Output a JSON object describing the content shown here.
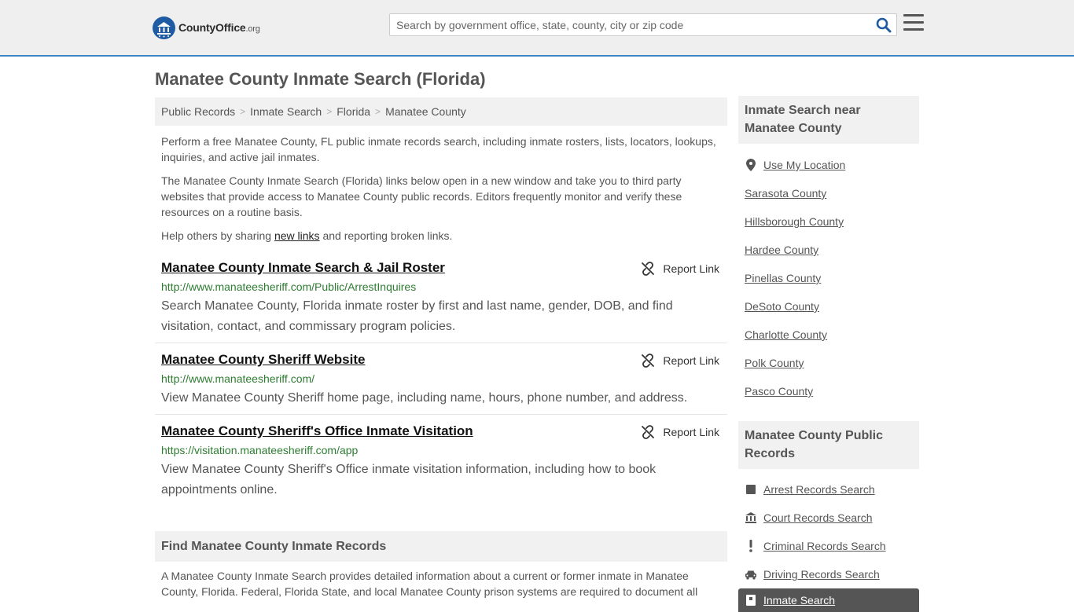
{
  "header": {
    "logo_main": "CountyOffice",
    "logo_tld": ".org",
    "search_placeholder": "Search by government office, state, county, city or zip code",
    "search_icon": "search-icon",
    "menu_icon": "hamburger-menu-icon"
  },
  "page": {
    "title": "Manatee County Inmate Search (Florida)"
  },
  "breadcrumb": [
    {
      "label": "Public Records"
    },
    {
      "label": "Inmate Search"
    },
    {
      "label": "Florida"
    },
    {
      "label": "Manatee County"
    }
  ],
  "intro": {
    "p1": "Perform a free Manatee County, FL public inmate records search, including inmate rosters, lists, locators, lookups, inquiries, and active jail inmates.",
    "p2": "The Manatee County Inmate Search (Florida) links below open in a new window and take you to third party websites that provide access to Manatee County public records. Editors frequently monitor and verify these resources on a routine basis.",
    "p3_before": "Help others by sharing ",
    "p3_link": "new links",
    "p3_after": " and reporting broken links."
  },
  "results": [
    {
      "title": "Manatee County Inmate Search & Jail Roster",
      "url": "http://www.manateesheriff.com/Public/ArrestInquires",
      "description": "Search Manatee County, Florida inmate roster by first and last name, gender, DOB, and find visitation, contact, and commissary program policies.",
      "report_label": "Report Link"
    },
    {
      "title": "Manatee County Sheriff Website",
      "url": "http://www.manateesheriff.com/",
      "description": "View Manatee County Sheriff home page, including name, hours, phone number, and address.",
      "report_label": "Report Link"
    },
    {
      "title": "Manatee County Sheriff's Office Inmate Visitation",
      "url": "https://visitation.manateesheriff.com/app",
      "description": "View Manatee County Sheriff's Office inmate visitation information, including how to book appointments online.",
      "report_label": "Report Link"
    }
  ],
  "find_section": {
    "heading": "Find Manatee County Inmate Records",
    "text": "A Manatee County Inmate Search provides detailed information about a current or former inmate in Manatee County, Florida. Federal, Florida State, and local Manatee County prison systems are required to document all"
  },
  "sidebar": {
    "nearby_heading": "Inmate Search near Manatee County",
    "use_location": "Use My Location",
    "nearby": [
      "Sarasota County",
      "Hillsborough County",
      "Hardee County",
      "Pinellas County",
      "DeSoto County",
      "Charlotte County",
      "Polk County",
      "Pasco County"
    ],
    "records_heading": "Manatee County Public Records",
    "records": [
      {
        "label": "Arrest Records Search",
        "icon": "square-icon"
      },
      {
        "label": "Court Records Search",
        "icon": "courthouse-icon"
      },
      {
        "label": "Criminal Records Search",
        "icon": "exclamation-icon"
      },
      {
        "label": "Driving Records Search",
        "icon": "car-icon"
      }
    ],
    "active_record": {
      "label": "Inmate Search",
      "icon": "inmate-icon"
    }
  },
  "colors": {
    "accent_border": "#3c84c4",
    "logo_blue": "#1f5ba3",
    "url_green": "#2e7d32",
    "panel_gray": "#f1f1f1",
    "active_item": "#555555"
  }
}
